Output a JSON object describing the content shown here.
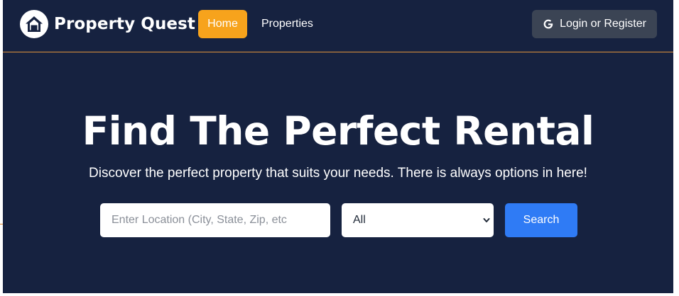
{
  "navbar": {
    "brand": "Property Quest",
    "links": {
      "home": "Home",
      "properties": "Properties"
    },
    "login_label": "Login or Register"
  },
  "hero": {
    "title": "Find The Perfect Rental",
    "subtitle": "Discover the perfect property that suits your needs. There is always options in here!"
  },
  "search": {
    "location_placeholder": "Enter Location (City, State, Zip, etc",
    "type_selected": "All",
    "button_label": "Search"
  },
  "icons": {
    "logo": "house-icon",
    "login": "google-icon",
    "select": "chevron-down-icon"
  },
  "colors": {
    "background": "#162240",
    "accent": "#f7a31c",
    "primary_button": "#2f7bf5",
    "login_button": "#3b4454",
    "nav_divider": "#e3953c"
  }
}
